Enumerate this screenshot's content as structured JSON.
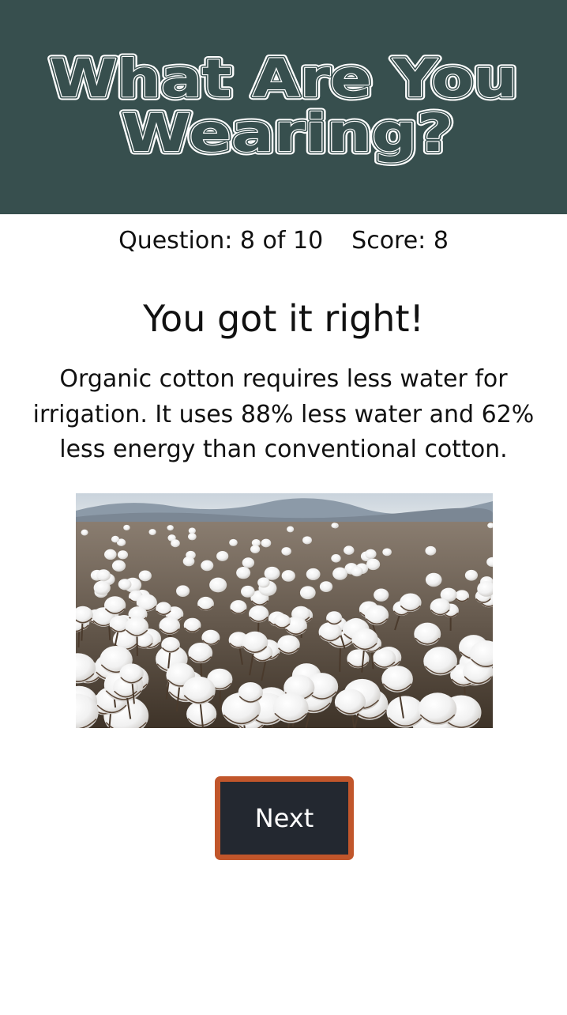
{
  "header": {
    "title_line1": "What Are You",
    "title_line2": "Wearing?"
  },
  "status": {
    "question_label": "Question: 8 of 10",
    "score_label": "Score: 8"
  },
  "result": {
    "heading": "You got it right!",
    "explanation": "Organic cotton requires less water for irrigation. It uses 88% less water and 62% less energy than conventional cotton."
  },
  "image": {
    "subject": "cotton-field-photo"
  },
  "next_button": {
    "label": "Next"
  },
  "colors": {
    "header_bg": "#374f4e",
    "button_bg": "#232830",
    "button_border": "#c1562b"
  }
}
